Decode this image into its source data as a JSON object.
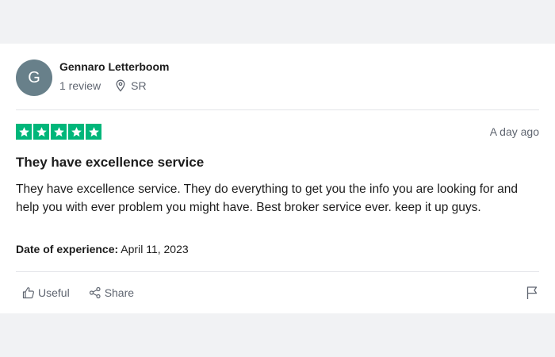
{
  "reviewer": {
    "initial": "G",
    "name": "Gennaro Letterboom",
    "review_count": "1 review",
    "location": "SR"
  },
  "rating": {
    "stars": 5,
    "max": 5,
    "color": "#00b67a"
  },
  "review": {
    "date": "A day ago",
    "title": "They have excellence service",
    "body": "They have excellence service. They do everything to get you the info you are looking for and help you with ever problem you might have. Best broker service ever. keep it up guys.",
    "experience_label": "Date of experience:",
    "experience_date": "April 11, 2023"
  },
  "actions": {
    "useful_label": "Useful",
    "share_label": "Share"
  },
  "icons": {
    "location": "location-pin-icon",
    "useful": "thumbs-up-icon",
    "share": "share-icon",
    "flag": "flag-icon",
    "star": "star-icon"
  }
}
